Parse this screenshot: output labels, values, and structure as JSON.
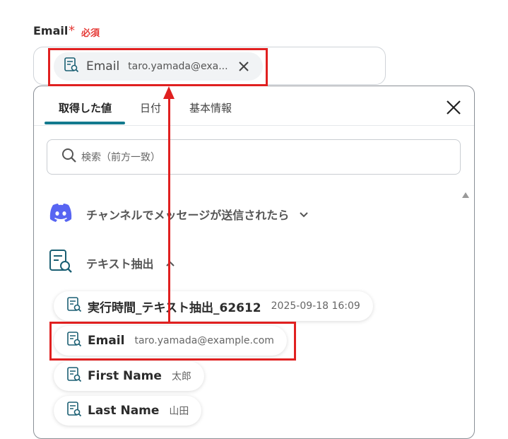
{
  "field": {
    "label": "Email",
    "required_mark": "*",
    "required_text": "必須",
    "selected_chip": {
      "name": "Email",
      "value": "taro.yamada@exa..."
    }
  },
  "panel": {
    "tabs": [
      {
        "label": "取得した値",
        "active": true
      },
      {
        "label": "日付",
        "active": false
      },
      {
        "label": "基本情報",
        "active": false
      }
    ],
    "search_placeholder": "検索（前方一致）",
    "sections": [
      {
        "title": "チャンネルでメッセージが送信されたら",
        "icon": "discord-icon",
        "expanded": false
      },
      {
        "title": "テキスト抽出",
        "icon": "text-extract-icon",
        "expanded": true
      }
    ],
    "items": [
      {
        "name": "実行時間_テキスト抽出_62612",
        "value": "2025-09-18 16:09"
      },
      {
        "name": "Email",
        "value": "taro.yamada@example.com"
      },
      {
        "name": "First Name",
        "value": "太郎"
      },
      {
        "name": "Last Name",
        "value": "山田"
      }
    ]
  },
  "colors": {
    "accent": "#137a8e",
    "required": "#e53935",
    "annotation": "#e02020",
    "discord": "#5865f2"
  }
}
